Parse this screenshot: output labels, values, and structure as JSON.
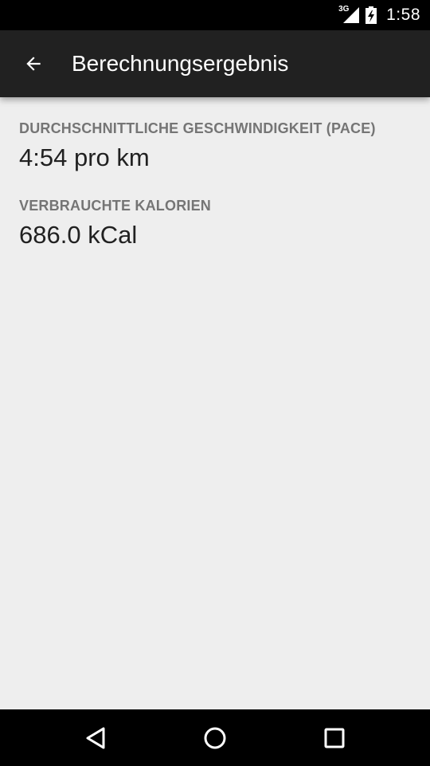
{
  "status_bar": {
    "network_type": "3G",
    "time": "1:58",
    "icons": [
      "signal-icon",
      "battery-charging-icon"
    ]
  },
  "app_bar": {
    "title": "Berechnungsergebnis",
    "back_icon": "arrow-back-icon"
  },
  "results": [
    {
      "label": "DURCHSCHNITTLICHE GESCHWINDIGKEIT (PACE)",
      "value": "4:54 pro km"
    },
    {
      "label": "VERBRAUCHTE KALORIEN",
      "value": "686.0 kCal"
    }
  ],
  "nav_bar": {
    "icons": [
      "back-triangle-icon",
      "home-circle-icon",
      "recents-square-icon"
    ]
  },
  "colors": {
    "status_bar": "#000000",
    "app_bar": "#212121",
    "background": "#eeeeee",
    "label": "#757575",
    "value": "#212121"
  }
}
